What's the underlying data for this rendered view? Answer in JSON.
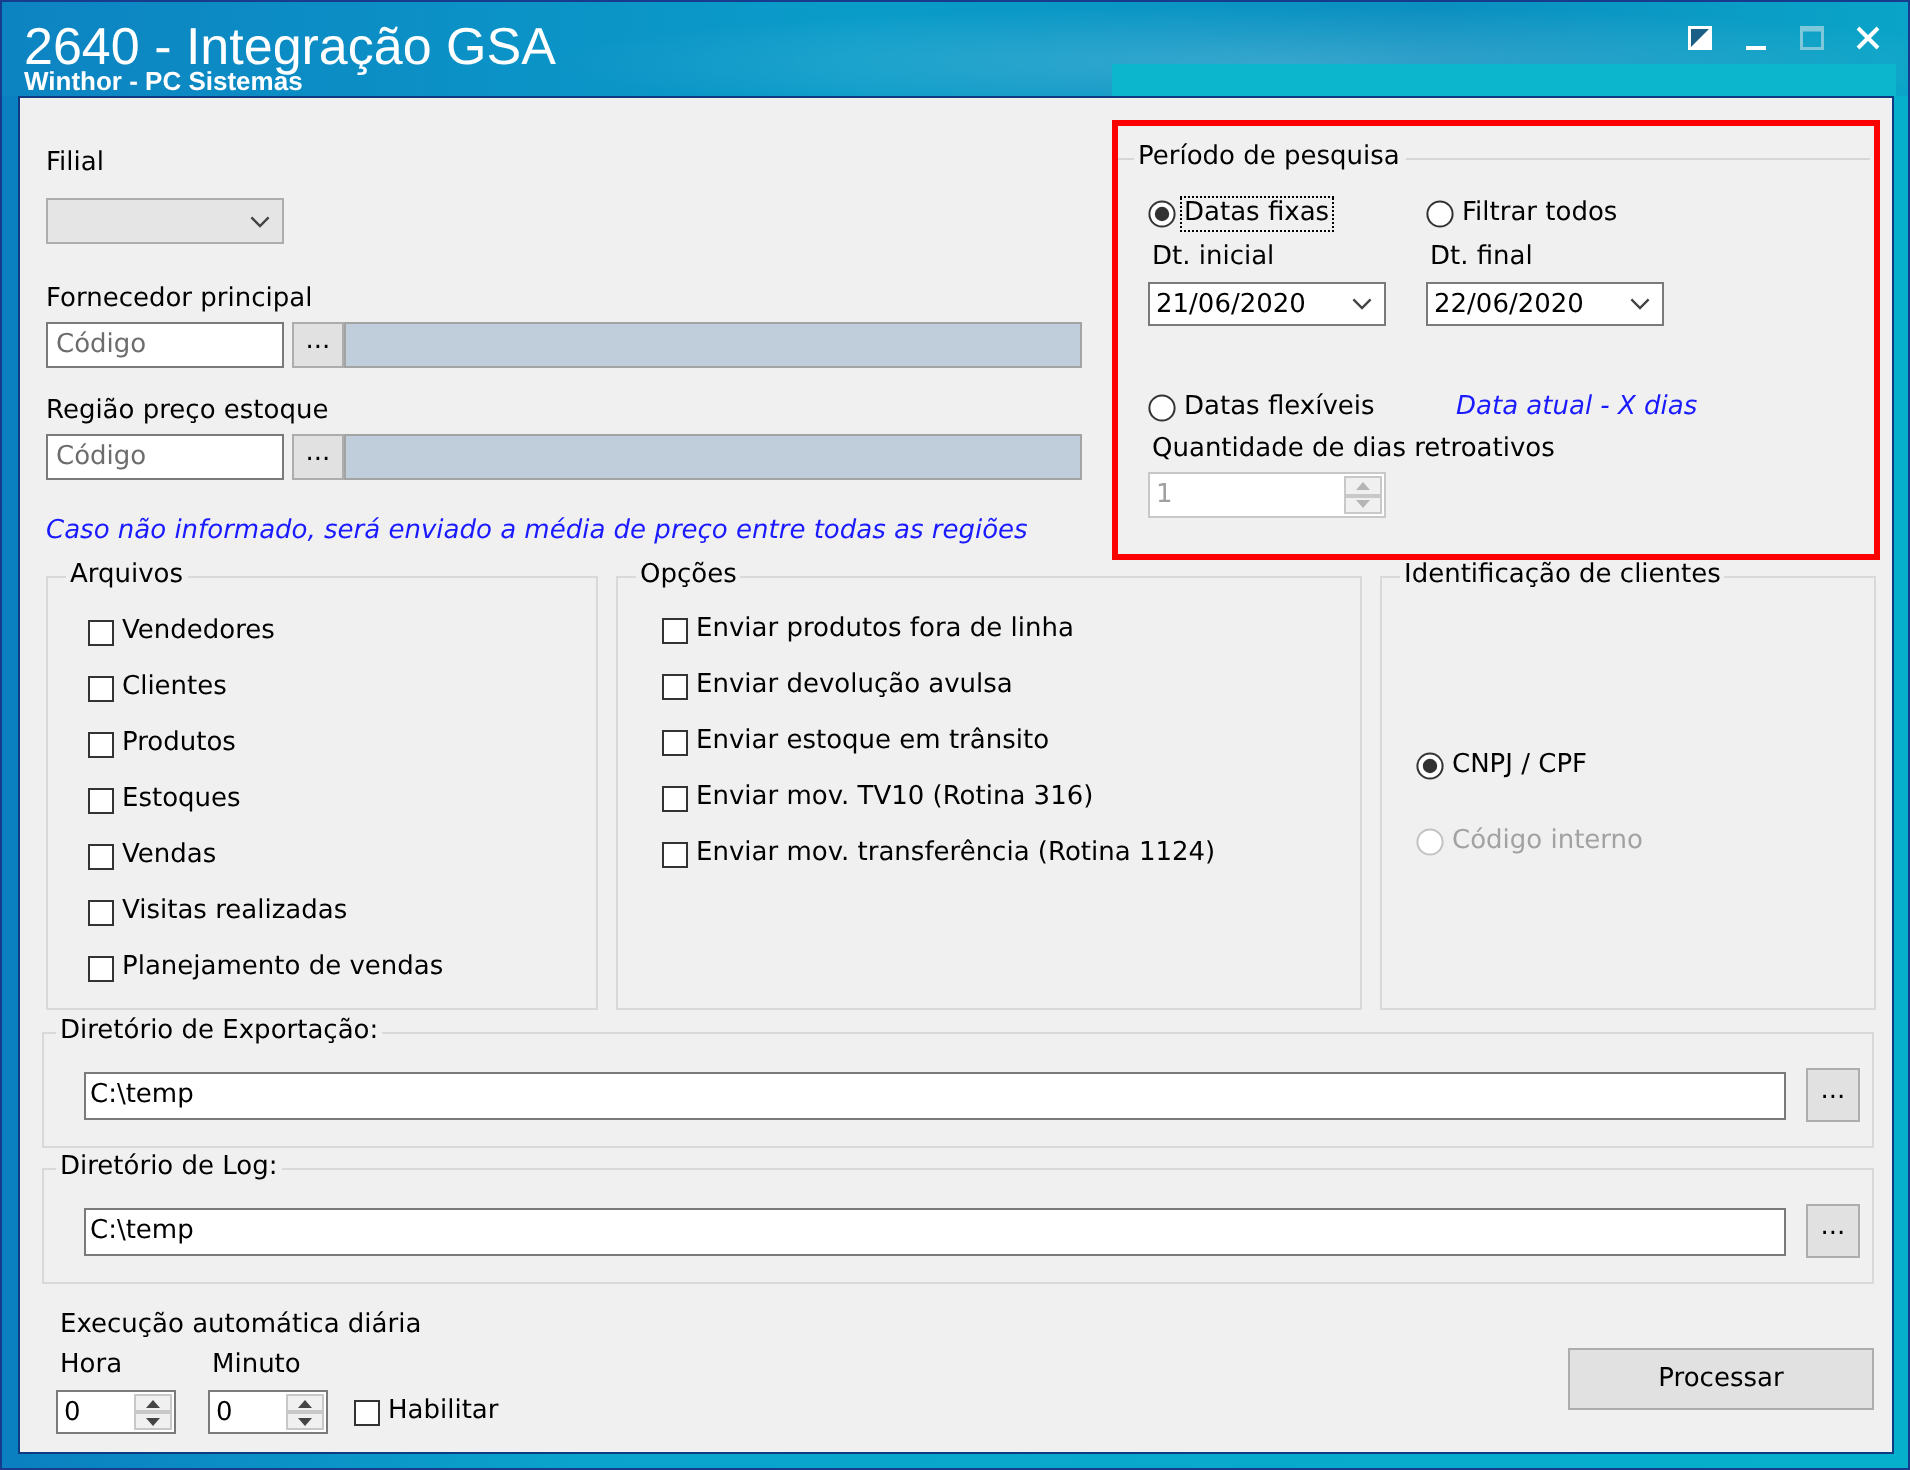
{
  "window": {
    "title": "2640 - Integração GSA",
    "subtitle": "Winthor - PC Sistemas",
    "buttons": [
      {
        "kind": "theme",
        "disabled": false
      },
      {
        "kind": "minimize",
        "disabled": false
      },
      {
        "kind": "maximize",
        "disabled": true
      },
      {
        "kind": "close",
        "disabled": false
      }
    ]
  },
  "filters": {
    "branch": {
      "label": "Filial"
    },
    "supplier": {
      "label": "Fornecedor principal",
      "placeholder": "Código",
      "lookup_button": "..."
    },
    "price_region": {
      "label": "Região preço estoque",
      "placeholder": "Código",
      "lookup_button": "..."
    },
    "note": "Caso não informado, será enviado a média de preço entre todas as regiões"
  },
  "period": {
    "title": "Período de pesquisa",
    "highlighted": true,
    "modes": [
      {
        "label": "Datas fixas",
        "selected": true,
        "focused": true
      },
      {
        "label": "Filtrar todos",
        "selected": false,
        "focused": false
      },
      {
        "label": "Datas flexíveis",
        "selected": false,
        "focused": false
      }
    ],
    "start": {
      "label": "Dt. inicial",
      "value": "21/06/2020"
    },
    "end": {
      "label": "Dt. final",
      "value": "22/06/2020"
    },
    "flexible_hint": "Data atual - X dias",
    "days": {
      "label": "Quantidade de dias retroativos",
      "value": "1",
      "disabled": true
    }
  },
  "files": {
    "title": "Arquivos",
    "items": [
      {
        "label": "Vendedores",
        "checked": false
      },
      {
        "label": "Clientes",
        "checked": false
      },
      {
        "label": "Produtos",
        "checked": false
      },
      {
        "label": "Estoques",
        "checked": false
      },
      {
        "label": "Vendas",
        "checked": false
      },
      {
        "label": "Visitas realizadas",
        "checked": false
      },
      {
        "label": "Planejamento de vendas",
        "checked": false
      }
    ]
  },
  "options": {
    "title": "Opções",
    "items": [
      {
        "label": "Enviar produtos fora de linha",
        "checked": false
      },
      {
        "label": "Enviar devolução avulsa",
        "checked": false
      },
      {
        "label": "Enviar estoque em trânsito",
        "checked": false
      },
      {
        "label": "Enviar mov. TV10 (Rotina 316)",
        "checked": false
      },
      {
        "label": "Enviar mov. transferência (Rotina 1124)",
        "checked": false
      }
    ]
  },
  "client_id": {
    "title": "Identificação de clientes",
    "items": [
      {
        "label": "CNPJ / CPF",
        "selected": true,
        "disabled": false
      },
      {
        "label": "Código interno",
        "selected": false,
        "disabled": true
      }
    ]
  },
  "export_dir": {
    "title": "Diretório de Exportação:",
    "value": "C:\\temp",
    "browse_button": "..."
  },
  "log_dir": {
    "title": "Diretório de Log:",
    "value": "C:\\temp",
    "browse_button": "..."
  },
  "schedule": {
    "title": "Execução automática diária",
    "hour": {
      "label": "Hora",
      "value": "0"
    },
    "minute": {
      "label": "Minuto",
      "value": "0"
    },
    "enable": {
      "label": "Habilitar",
      "checked": false
    }
  },
  "process_button": "Processar"
}
